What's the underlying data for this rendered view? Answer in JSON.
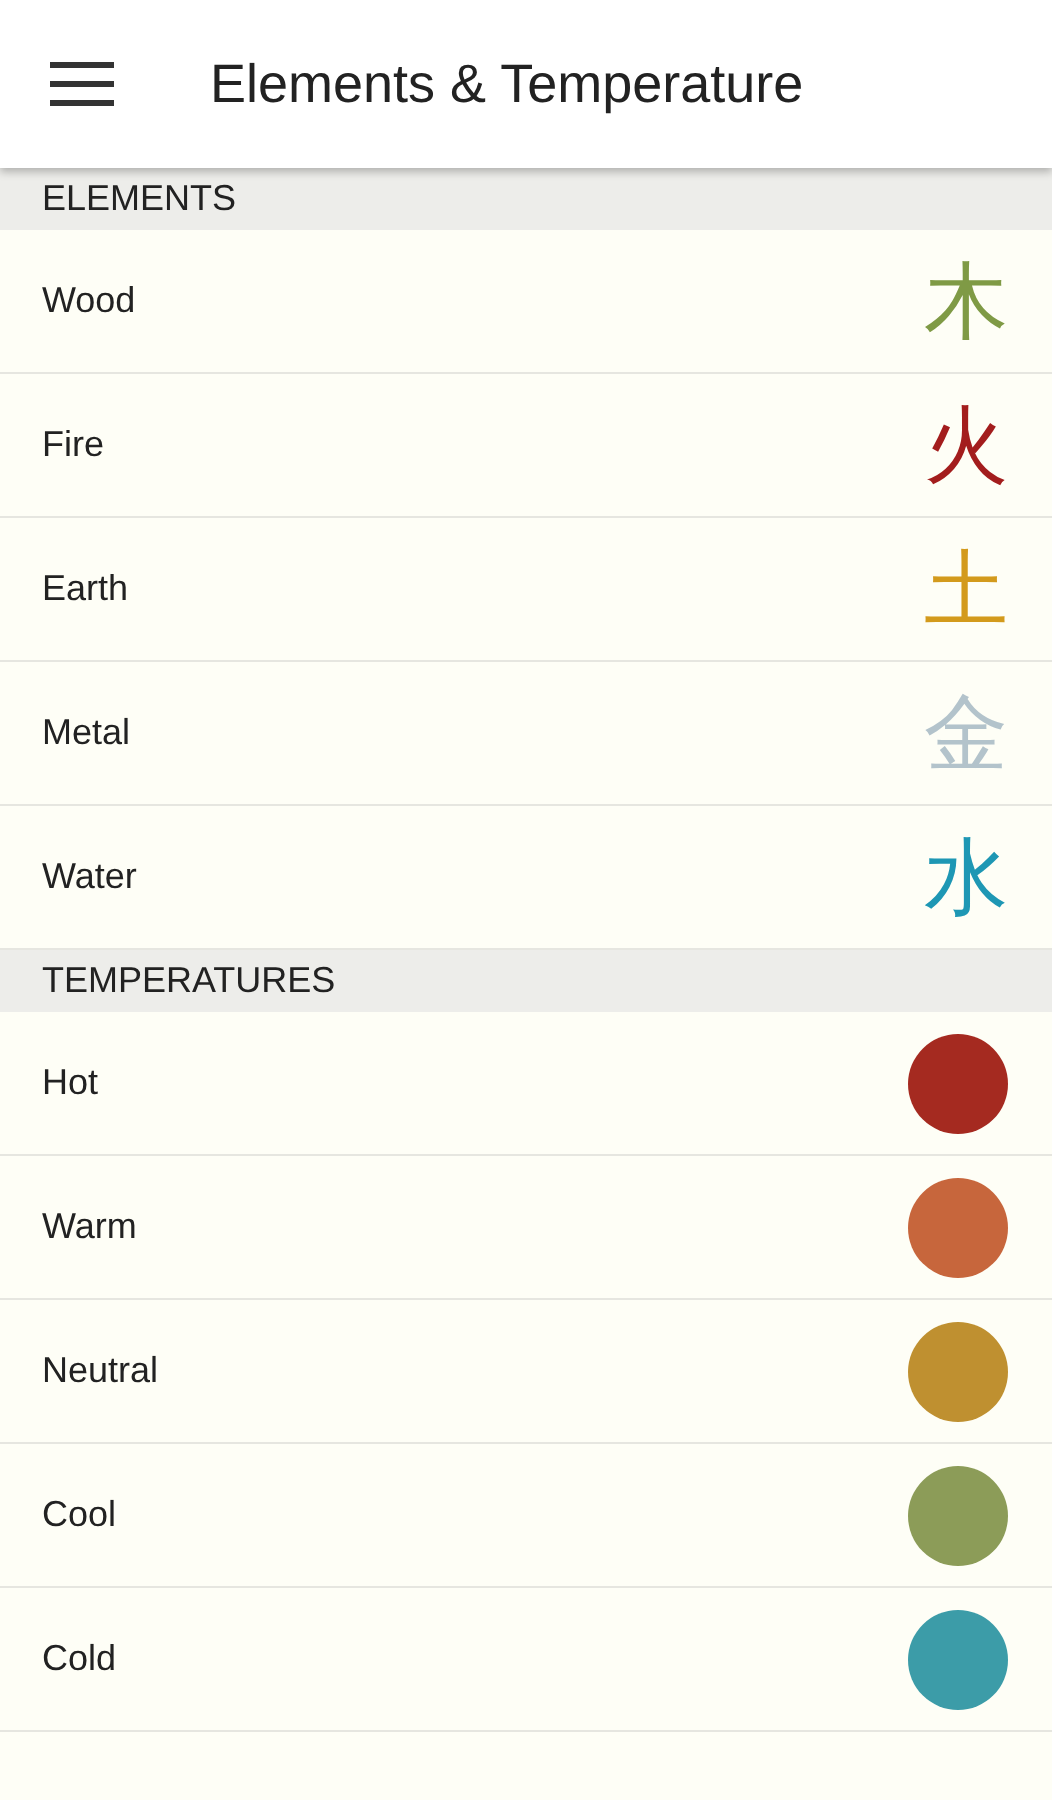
{
  "app_bar": {
    "title": "Elements & Temperature"
  },
  "sections": [
    {
      "header": "ELEMENTS",
      "items": [
        {
          "kind": "glyph",
          "label": "Wood",
          "glyph": "木",
          "color": "#7f9a45"
        },
        {
          "kind": "glyph",
          "label": "Fire",
          "glyph": "火",
          "color": "#a31d1d"
        },
        {
          "kind": "glyph",
          "label": "Earth",
          "glyph": "土",
          "color": "#d39a1c"
        },
        {
          "kind": "glyph",
          "label": "Metal",
          "glyph": "金",
          "color": "#b3c3cb"
        },
        {
          "kind": "glyph",
          "label": "Water",
          "glyph": "水",
          "color": "#1e97b4"
        }
      ]
    },
    {
      "header": "TEMPERATURES",
      "items": [
        {
          "kind": "dot",
          "label": "Hot",
          "color": "#a52a20"
        },
        {
          "kind": "dot",
          "label": "Warm",
          "color": "#c7663c"
        },
        {
          "kind": "dot",
          "label": "Neutral",
          "color": "#bf9030"
        },
        {
          "kind": "dot",
          "label": "Cool",
          "color": "#8c9c58"
        },
        {
          "kind": "dot",
          "label": "Cold",
          "color": "#3c9ca8"
        }
      ]
    }
  ]
}
